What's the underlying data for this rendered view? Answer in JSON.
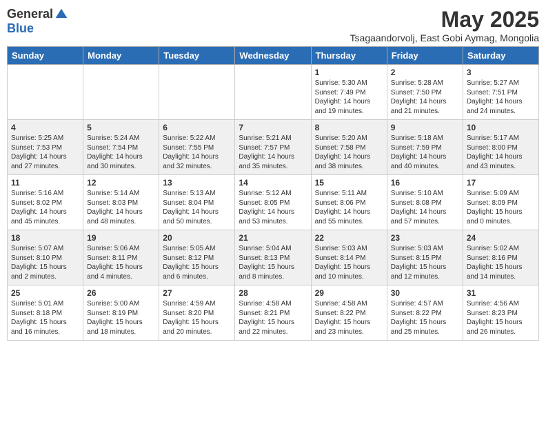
{
  "logo": {
    "general": "General",
    "blue": "Blue"
  },
  "title": "May 2025",
  "subtitle": "Tsagaandorvolj, East Gobi Aymag, Mongolia",
  "days_of_week": [
    "Sunday",
    "Monday",
    "Tuesday",
    "Wednesday",
    "Thursday",
    "Friday",
    "Saturday"
  ],
  "weeks": [
    [
      {
        "num": "",
        "info": ""
      },
      {
        "num": "",
        "info": ""
      },
      {
        "num": "",
        "info": ""
      },
      {
        "num": "",
        "info": ""
      },
      {
        "num": "1",
        "info": "Sunrise: 5:30 AM\nSunset: 7:49 PM\nDaylight: 14 hours\nand 19 minutes."
      },
      {
        "num": "2",
        "info": "Sunrise: 5:28 AM\nSunset: 7:50 PM\nDaylight: 14 hours\nand 21 minutes."
      },
      {
        "num": "3",
        "info": "Sunrise: 5:27 AM\nSunset: 7:51 PM\nDaylight: 14 hours\nand 24 minutes."
      }
    ],
    [
      {
        "num": "4",
        "info": "Sunrise: 5:25 AM\nSunset: 7:53 PM\nDaylight: 14 hours\nand 27 minutes."
      },
      {
        "num": "5",
        "info": "Sunrise: 5:24 AM\nSunset: 7:54 PM\nDaylight: 14 hours\nand 30 minutes."
      },
      {
        "num": "6",
        "info": "Sunrise: 5:22 AM\nSunset: 7:55 PM\nDaylight: 14 hours\nand 32 minutes."
      },
      {
        "num": "7",
        "info": "Sunrise: 5:21 AM\nSunset: 7:57 PM\nDaylight: 14 hours\nand 35 minutes."
      },
      {
        "num": "8",
        "info": "Sunrise: 5:20 AM\nSunset: 7:58 PM\nDaylight: 14 hours\nand 38 minutes."
      },
      {
        "num": "9",
        "info": "Sunrise: 5:18 AM\nSunset: 7:59 PM\nDaylight: 14 hours\nand 40 minutes."
      },
      {
        "num": "10",
        "info": "Sunrise: 5:17 AM\nSunset: 8:00 PM\nDaylight: 14 hours\nand 43 minutes."
      }
    ],
    [
      {
        "num": "11",
        "info": "Sunrise: 5:16 AM\nSunset: 8:02 PM\nDaylight: 14 hours\nand 45 minutes."
      },
      {
        "num": "12",
        "info": "Sunrise: 5:14 AM\nSunset: 8:03 PM\nDaylight: 14 hours\nand 48 minutes."
      },
      {
        "num": "13",
        "info": "Sunrise: 5:13 AM\nSunset: 8:04 PM\nDaylight: 14 hours\nand 50 minutes."
      },
      {
        "num": "14",
        "info": "Sunrise: 5:12 AM\nSunset: 8:05 PM\nDaylight: 14 hours\nand 53 minutes."
      },
      {
        "num": "15",
        "info": "Sunrise: 5:11 AM\nSunset: 8:06 PM\nDaylight: 14 hours\nand 55 minutes."
      },
      {
        "num": "16",
        "info": "Sunrise: 5:10 AM\nSunset: 8:08 PM\nDaylight: 14 hours\nand 57 minutes."
      },
      {
        "num": "17",
        "info": "Sunrise: 5:09 AM\nSunset: 8:09 PM\nDaylight: 15 hours\nand 0 minutes."
      }
    ],
    [
      {
        "num": "18",
        "info": "Sunrise: 5:07 AM\nSunset: 8:10 PM\nDaylight: 15 hours\nand 2 minutes."
      },
      {
        "num": "19",
        "info": "Sunrise: 5:06 AM\nSunset: 8:11 PM\nDaylight: 15 hours\nand 4 minutes."
      },
      {
        "num": "20",
        "info": "Sunrise: 5:05 AM\nSunset: 8:12 PM\nDaylight: 15 hours\nand 6 minutes."
      },
      {
        "num": "21",
        "info": "Sunrise: 5:04 AM\nSunset: 8:13 PM\nDaylight: 15 hours\nand 8 minutes."
      },
      {
        "num": "22",
        "info": "Sunrise: 5:03 AM\nSunset: 8:14 PM\nDaylight: 15 hours\nand 10 minutes."
      },
      {
        "num": "23",
        "info": "Sunrise: 5:03 AM\nSunset: 8:15 PM\nDaylight: 15 hours\nand 12 minutes."
      },
      {
        "num": "24",
        "info": "Sunrise: 5:02 AM\nSunset: 8:16 PM\nDaylight: 15 hours\nand 14 minutes."
      }
    ],
    [
      {
        "num": "25",
        "info": "Sunrise: 5:01 AM\nSunset: 8:18 PM\nDaylight: 15 hours\nand 16 minutes."
      },
      {
        "num": "26",
        "info": "Sunrise: 5:00 AM\nSunset: 8:19 PM\nDaylight: 15 hours\nand 18 minutes."
      },
      {
        "num": "27",
        "info": "Sunrise: 4:59 AM\nSunset: 8:20 PM\nDaylight: 15 hours\nand 20 minutes."
      },
      {
        "num": "28",
        "info": "Sunrise: 4:58 AM\nSunset: 8:21 PM\nDaylight: 15 hours\nand 22 minutes."
      },
      {
        "num": "29",
        "info": "Sunrise: 4:58 AM\nSunset: 8:22 PM\nDaylight: 15 hours\nand 23 minutes."
      },
      {
        "num": "30",
        "info": "Sunrise: 4:57 AM\nSunset: 8:22 PM\nDaylight: 15 hours\nand 25 minutes."
      },
      {
        "num": "31",
        "info": "Sunrise: 4:56 AM\nSunset: 8:23 PM\nDaylight: 15 hours\nand 26 minutes."
      }
    ]
  ]
}
